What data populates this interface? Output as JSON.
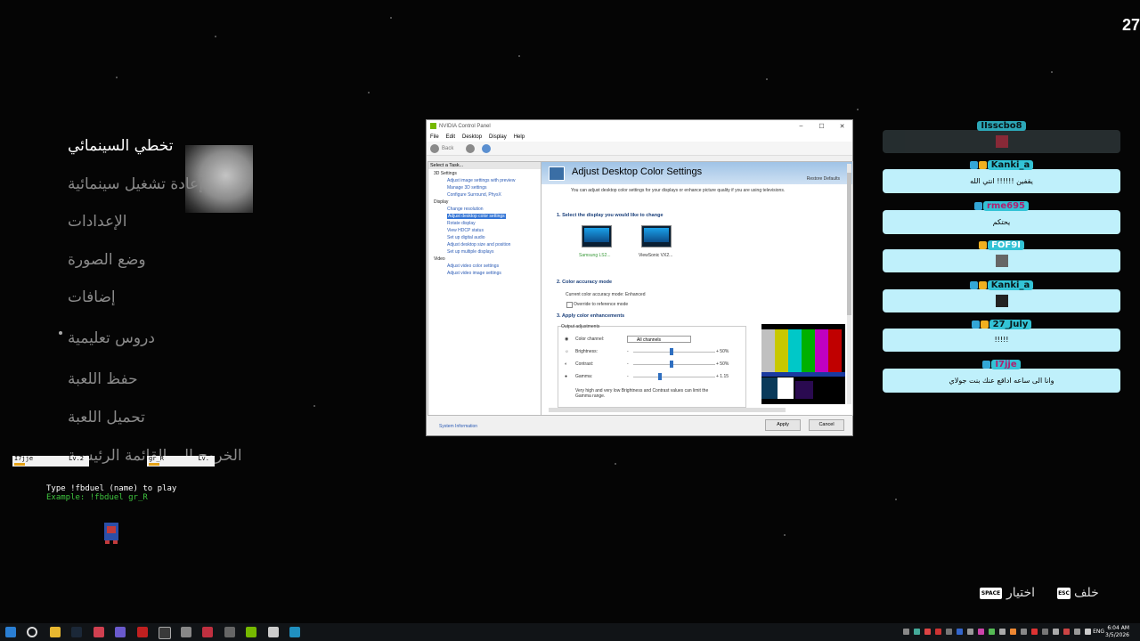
{
  "corner_counter": "27",
  "menu": {
    "items": [
      {
        "label": "تخطي السينمائي",
        "active": true
      },
      {
        "label": "إعادة تشغيل سينمائية"
      },
      {
        "label": "الإعدادات"
      },
      {
        "label": "وضع الصورة"
      },
      {
        "label": "إضافات"
      },
      {
        "label": "دروس تعليمية"
      },
      {
        "label": "حفظ اللعبة"
      },
      {
        "label": "تحميل اللعبة"
      },
      {
        "label": "الخروج إلى القائمة الرئيسية"
      }
    ]
  },
  "overlay": {
    "player1": {
      "name": "I7jje",
      "level": "Lv.2",
      "hp": "HP"
    },
    "player2": {
      "name": "gr_R",
      "level": "Lv.",
      "hp": "HP"
    },
    "line1": "Type !fbduel (name) to play",
    "line2": "Example: !fbduel gr_R"
  },
  "nvidia": {
    "window_title": "NVIDIA Control Panel",
    "menus": [
      "File",
      "Edit",
      "Desktop",
      "Display",
      "Help"
    ],
    "back_label": "Back",
    "task_head": "Select a Task...",
    "tree": {
      "c1": "3D Settings",
      "s1": "Adjust image settings with preview",
      "s2": "Manage 3D settings",
      "s3": "Configure Surround, PhysX",
      "c2": "Display",
      "s4": "Change resolution",
      "s5": "Adjust desktop color settings",
      "s6": "Rotate display",
      "s7": "View HDCP status",
      "s8": "Set up digital audio",
      "s9": "Adjust desktop size and position",
      "s10": "Set up multiple displays",
      "c3": "Video",
      "s11": "Adjust video color settings",
      "s12": "Adjust video image settings"
    },
    "page_title": "Adjust Desktop Color Settings",
    "restore_defaults": "Restore Defaults",
    "intro": "You can adjust desktop color settings for your displays or enhance picture quality if you are using televisions.",
    "sec1": "1. Select the display you would like to change",
    "display1": "Samsung LS2...",
    "display2": "ViewSonic VX2...",
    "sec2": "2. Color accuracy mode",
    "accuracy_current": "Current color accuracy mode: Enhanced",
    "override": "Override to reference mode",
    "sec3": "3. Apply color enhancements",
    "output_adj": "Output adjustments",
    "color_channel_label": "Color channel:",
    "color_channel_value": "All channels",
    "brightness_label": "Brightness:",
    "brightness_value": "+ 50%",
    "contrast_label": "Contrast:",
    "contrast_value": "+ 50%",
    "gamma_label": "Gamma:",
    "gamma_value": "+ 1.15",
    "minus": "-",
    "note": "Very high and very low Brightness and Contrast values can limit the Gamma range.",
    "system_info": "System Information",
    "apply": "Apply",
    "cancel": "Cancel"
  },
  "chat": {
    "messages": [
      {
        "name": "IIsscbo8",
        "text": ""
      },
      {
        "name": "Kanki_a",
        "text": "يقفين !!!!!! انتي الله"
      },
      {
        "name": "rme695",
        "text": "يحتكم"
      },
      {
        "name": "FOF9I",
        "text": ""
      },
      {
        "name": "Kanki_a",
        "text": ""
      },
      {
        "name": "27_July",
        "text": "!!!!!"
      },
      {
        "name": "I7jje",
        "text": "وانا الى ساعه اداقع عنك بنت جولاي"
      }
    ]
  },
  "hints": {
    "back": "خلف",
    "back_key": "ESC",
    "select": "اختيار",
    "select_key": "SPACE"
  },
  "taskbar": {
    "lang": "ENG",
    "time": "6:04 AM",
    "date": "3/5/2026"
  }
}
